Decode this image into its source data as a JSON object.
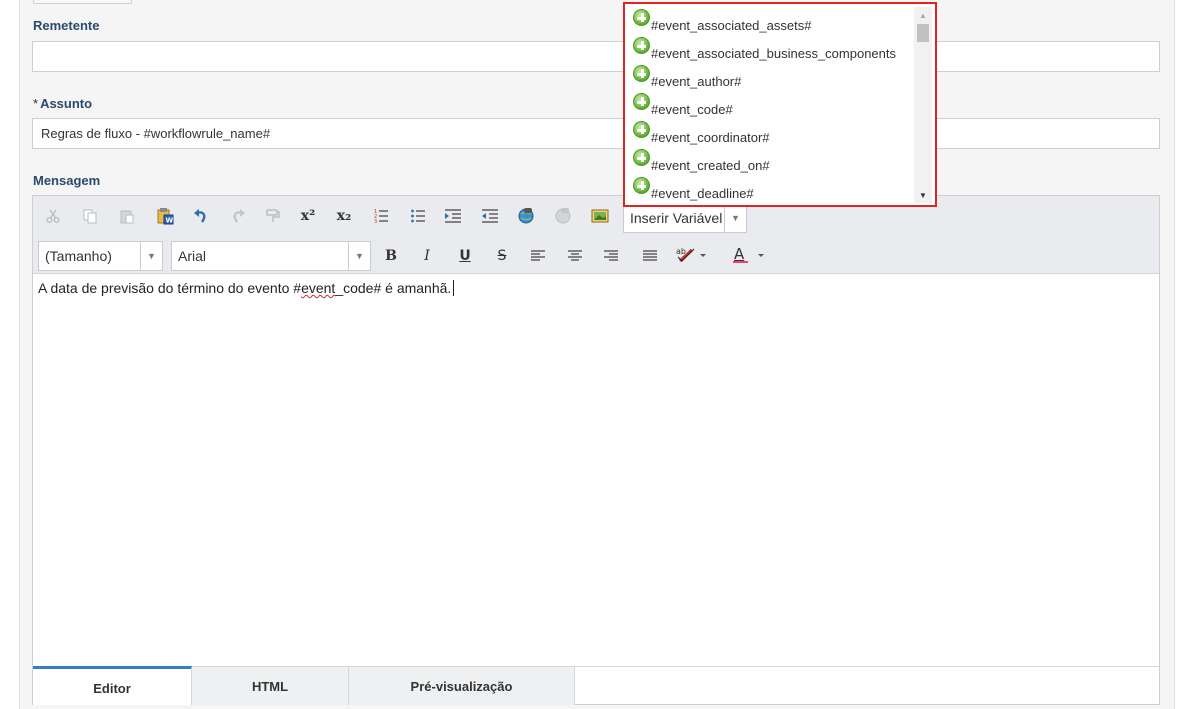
{
  "form": {
    "sender_label": "Remetente",
    "sender_value": "",
    "subject_required": "*",
    "subject_label": "Assunto",
    "subject_value": "Regras de fluxo - #workflowrule_name#",
    "message_label": "Mensagem"
  },
  "toolbar": {
    "font_size_value": "(Tamanho)",
    "font_family_value": "Arial",
    "insert_variable_label": "Inserir Variável",
    "bold": "B",
    "italic": "I",
    "underline": "U",
    "strike": "S",
    "superscript": "x²",
    "subscript": "x₂",
    "font_color": "A",
    "icons": [
      "cut-icon",
      "copy-icon",
      "paste-icon",
      "paste-word-icon",
      "undo-icon",
      "redo-icon",
      "format-painter-icon",
      "superscript-icon",
      "subscript-icon",
      "ordered-list-icon",
      "unordered-list-icon",
      "indent-icon",
      "outdent-icon",
      "link-icon",
      "unlink-icon",
      "image-icon",
      "bold-icon",
      "italic-icon",
      "underline-icon",
      "strikethrough-icon",
      "align-left-icon",
      "align-center-icon",
      "align-right-icon",
      "justify-icon",
      "spellcheck-icon",
      "font-color-icon"
    ]
  },
  "editor": {
    "text_before": "A data de previsão do término do evento #",
    "text_squiggle": "event",
    "text_after": "_code# é amanhã."
  },
  "tabs": [
    {
      "label": "Editor",
      "active": true
    },
    {
      "label": "HTML",
      "active": false
    },
    {
      "label": "Pré-visualização",
      "active": false
    }
  ],
  "variables_dropdown": {
    "items": [
      "#event_associated_assets#",
      "#event_associated_business_components",
      "#event_author#",
      "#event_code#",
      "#event_coordinator#",
      "#event_created_on#",
      "#event_deadline#"
    ]
  },
  "colors": {
    "highlight_border": "#e02424",
    "active_tab_accent": "#3b7dc4",
    "label_color": "#2a4a6b"
  }
}
